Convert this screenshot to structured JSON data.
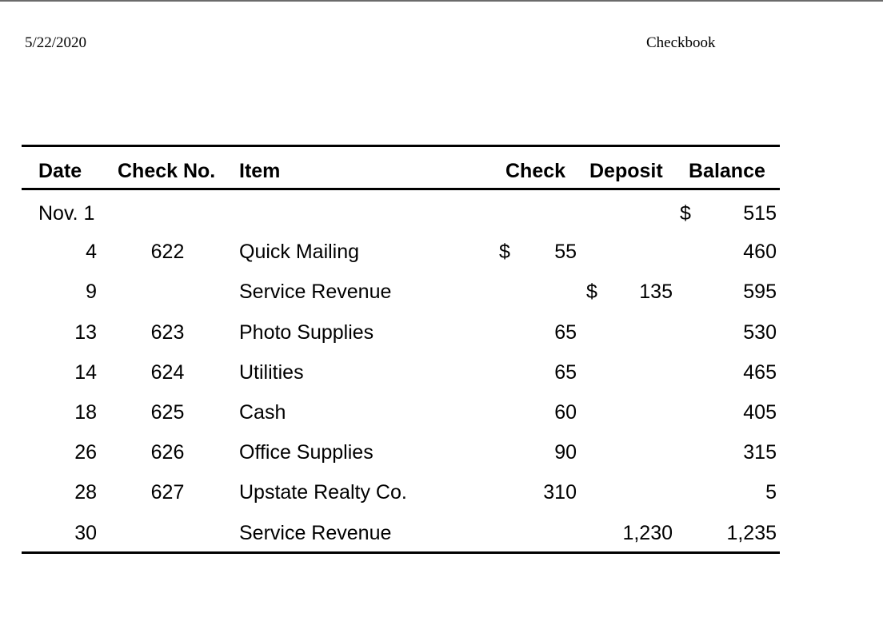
{
  "header": {
    "date": "5/22/2020",
    "title": "Checkbook"
  },
  "ledger": {
    "columns": {
      "date": "Date",
      "check_no": "Check No.",
      "item": "Item",
      "check": "Check",
      "deposit": "Deposit",
      "balance": "Balance"
    },
    "rows": [
      {
        "date": "Nov. 1",
        "check_no": "",
        "item": "",
        "check_sym": "",
        "check": "",
        "deposit_sym": "",
        "deposit": "",
        "balance_sym": "$",
        "balance": "515"
      },
      {
        "date": "4",
        "check_no": "622",
        "item": "Quick Mailing",
        "check_sym": "$",
        "check": "55",
        "deposit_sym": "",
        "deposit": "",
        "balance_sym": "",
        "balance": "460"
      },
      {
        "date": "9",
        "check_no": "",
        "item": "Service Revenue",
        "check_sym": "",
        "check": "",
        "deposit_sym": "$",
        "deposit": "135",
        "balance_sym": "",
        "balance": "595"
      },
      {
        "date": "13",
        "check_no": "623",
        "item": "Photo Supplies",
        "check_sym": "",
        "check": "65",
        "deposit_sym": "",
        "deposit": "",
        "balance_sym": "",
        "balance": "530"
      },
      {
        "date": "14",
        "check_no": "624",
        "item": "Utilities",
        "check_sym": "",
        "check": "65",
        "deposit_sym": "",
        "deposit": "",
        "balance_sym": "",
        "balance": "465"
      },
      {
        "date": "18",
        "check_no": "625",
        "item": "Cash",
        "check_sym": "",
        "check": "60",
        "deposit_sym": "",
        "deposit": "",
        "balance_sym": "",
        "balance": "405"
      },
      {
        "date": "26",
        "check_no": "626",
        "item": "Office Supplies",
        "check_sym": "",
        "check": "90",
        "deposit_sym": "",
        "deposit": "",
        "balance_sym": "",
        "balance": "315"
      },
      {
        "date": "28",
        "check_no": "627",
        "item": "Upstate Realty Co.",
        "check_sym": "",
        "check": "310",
        "deposit_sym": "",
        "deposit": "",
        "balance_sym": "",
        "balance": "5"
      },
      {
        "date": "30",
        "check_no": "",
        "item": "Service Revenue",
        "check_sym": "",
        "check": "",
        "deposit_sym": "",
        "deposit": "1,230",
        "balance_sym": "",
        "balance": "1,235"
      }
    ]
  }
}
